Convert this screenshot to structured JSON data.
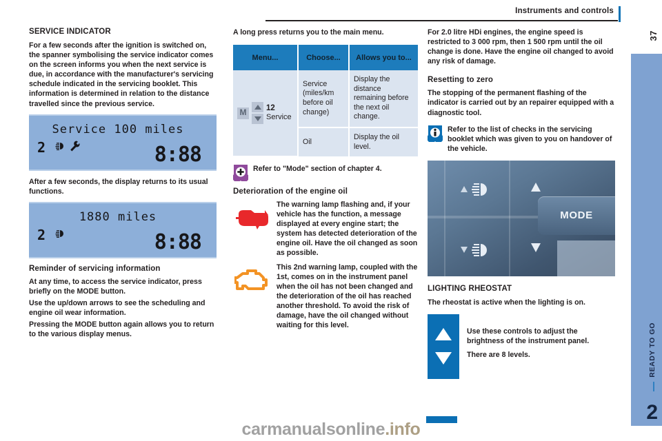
{
  "header": {
    "title": "Instruments and controls",
    "folio": "37"
  },
  "side_tab": {
    "label": "READY TO GO",
    "number": "2"
  },
  "watermark": {
    "text": "carmanualsonline",
    "suffix": ".info"
  },
  "colors": {
    "accent_blue": "#0b6fb4",
    "table_header": "#1d7cbc",
    "table_cell": "#dbe4f0",
    "lcd": "#8dafd9",
    "side_tab": "#7fa2d1",
    "warn_red": "#e8282b",
    "warn_amber": "#f39325",
    "shield_purple": "#8f4a9c",
    "shield_blue": "#0b6fb4"
  },
  "column_left": {
    "heading": "SERVICE INDICATOR",
    "intro": "For a few seconds after the ignition is switched on, the spanner symbolising the service indicator comes on the screen informs you when the next service is due, in accordance with the manufacturer's servicing schedule indicated in the servicing booklet. This information is determined in relation to the distance travelled since the previous service.",
    "display_1": {
      "top_text": "Service 100 miles",
      "gear": "2",
      "clock": "8:88",
      "icons": [
        "lamp-icon",
        "spanner-icon"
      ]
    },
    "after_text": "After a few seconds, the display returns to its usual functions.",
    "display_2": {
      "top_text": "1880 miles",
      "gear": "2",
      "clock": "8:88",
      "icons": [
        "lamp-icon"
      ]
    },
    "subheading": "Reminder of servicing information",
    "para_1": "At any time, to access the service indicator, press briefly on the MODE button.",
    "para_2": "Use the up/down arrows to see the scheduling and engine oil wear information.",
    "para_3": "Pressing the MODE button again allows you to return to the various display menus."
  },
  "column_middle": {
    "lead": "A long press returns you to the main menu.",
    "table": {
      "headers": [
        "Menu...",
        "Choose...",
        "Allows you to..."
      ],
      "menu_cell": {
        "mode_key": "M",
        "number": "12",
        "label": "Service"
      },
      "rows": [
        {
          "choose": "Service (miles/km before oil change)",
          "allows": "Display the distance remaining before the next oil change."
        },
        {
          "choose": "Oil",
          "allows": "Display the oil level."
        }
      ]
    },
    "note": "Refer to \"Mode\" section of chapter 4.",
    "subheading": "Deterioration of the engine oil",
    "warnings": [
      {
        "icon": "oil-pressure-warning-lamp-icon",
        "text": "The warning lamp flashing and, if your vehicle has the function, a message displayed at every engine start; the system has detected deterioration of the engine oil. Have the oil changed as soon as possible."
      },
      {
        "icon": "engine-check-warning-lamp-icon",
        "text": "This 2nd warning lamp, coupled with the 1st, comes on in the instrument panel when the oil has not been changed and the deterioration of the oil has reached another threshold. To avoid the risk of damage, have the oil changed without waiting for this level."
      }
    ]
  },
  "column_right": {
    "para_1": "For 2.0 litre HDi engines, the engine speed is restricted to 3 000 rpm, then 1 500 rpm until the oil change is done. Have the engine oil changed to avoid any risk of damage.",
    "subheading": "Resetting to zero",
    "para_2": "The stopping of the permanent flashing of the indicator is carried out by an repairer equipped with a diagnostic tool.",
    "info_note": "Refer to the list of checks in the servicing booklet which was given to you on handover of the vehicle.",
    "photo": {
      "mode_label": "MODE",
      "glyphs": [
        "headlight-adjust-up-icon",
        "arrow-up-icon",
        "headlight-adjust-down-icon",
        "arrow-down-icon"
      ]
    },
    "heading_2": "LIGHTING RHEOSTAT",
    "para_3": "The rheostat is active when the lighting is on.",
    "rheostat_text_1": "Use these controls to adjust the brightness of the instrument panel.",
    "rheostat_text_2": "There are 8 levels."
  }
}
